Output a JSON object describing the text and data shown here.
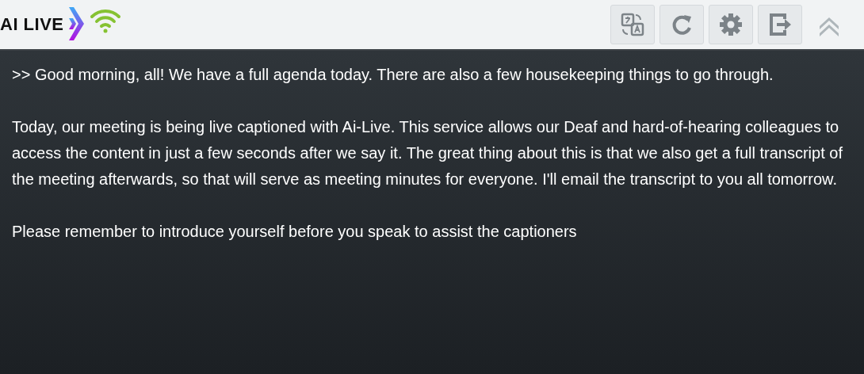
{
  "header": {
    "logo": "AI LIVE",
    "buttons": [
      {
        "kind": "translate"
      },
      {
        "kind": "refresh"
      },
      {
        "kind": "settings"
      },
      {
        "kind": "exit"
      },
      {
        "kind": "collapse"
      }
    ]
  },
  "transcript": [
    ">> Good morning, all! We have a full agenda today. There are also a few housekeeping things to go through.",
    "Today, our meeting is being live captioned with Ai-Live. This service allows our Deaf and hard-of-hearing colleagues to access the content in just a few seconds after we say it. The great thing about this is that we also get a full transcript of the meeting afterwards, so that will serve as meeting minutes for everyone. I'll email the transcript to you all tomorrow.",
    "Please remember to introduce yourself before you speak to assist the captioners"
  ]
}
